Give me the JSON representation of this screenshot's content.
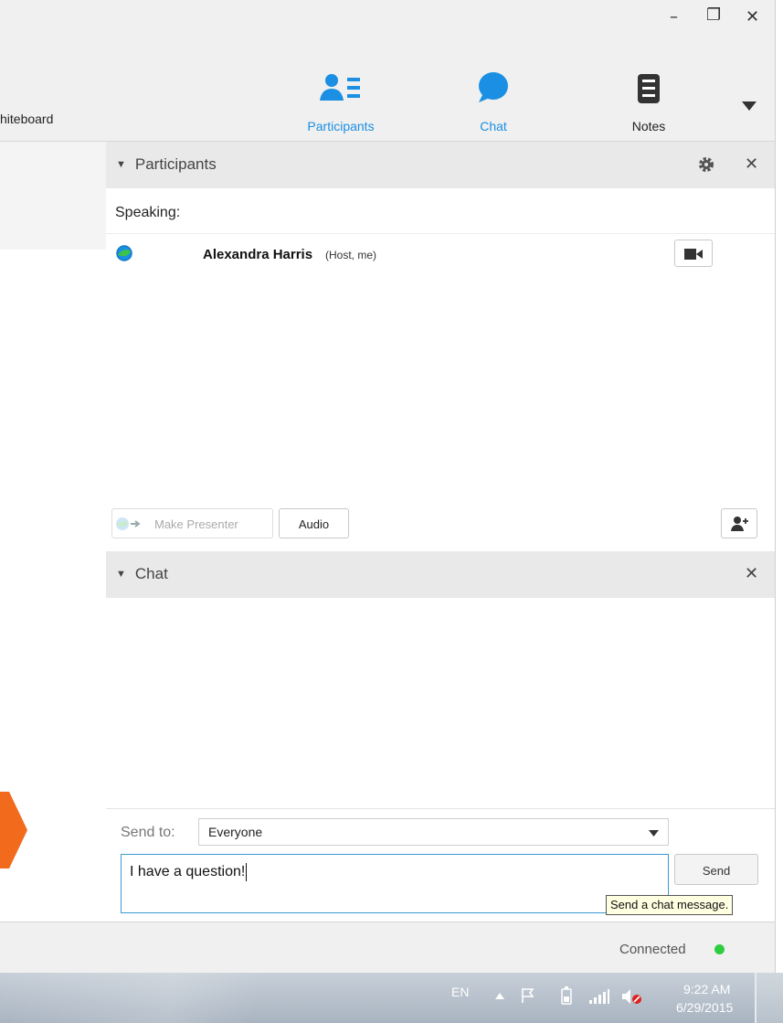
{
  "window": {
    "minimize": "–",
    "restore": "❐",
    "close": "✕"
  },
  "tabs": {
    "left_partial": "hiteboard",
    "participants": "Participants",
    "chat": "Chat",
    "notes": "Notes",
    "active_color": "#1a8fe3"
  },
  "participants_panel": {
    "title": "Participants",
    "speaking_label": "Speaking:",
    "participant": {
      "name": "Alexandra Harris",
      "role": "(Host, me)"
    },
    "make_presenter": "Make Presenter",
    "audio": "Audio"
  },
  "chat_panel": {
    "title": "Chat",
    "send_to_label": "Send to:",
    "send_to_value": "Everyone",
    "message": "I have a question!",
    "send_button": "Send",
    "tooltip": "Send a chat message."
  },
  "status": {
    "text": "Connected",
    "indicator_color": "#2ecc40"
  },
  "taskbar": {
    "lang": "EN",
    "time": "9:22 AM",
    "date": "6/29/2015"
  },
  "icons": {
    "participants": "participants-icon",
    "chat": "chat-bubble-icon",
    "notes": "notebook-icon",
    "settings": "gear-icon",
    "video": "video-camera-icon",
    "add_participant": "add-user-icon",
    "presenter": "presenter-ball-icon"
  }
}
